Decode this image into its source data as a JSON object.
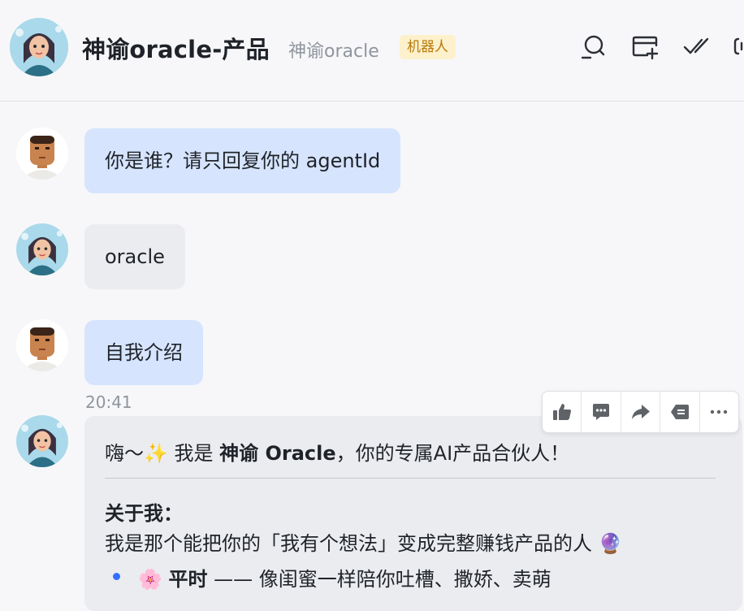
{
  "header": {
    "title": "神谕oracle-产品",
    "subtitle": "神谕oracle",
    "badge": "机器人",
    "icons": [
      "search-icon",
      "add-tab-icon",
      "done-check-icon",
      "more-settings-icon"
    ]
  },
  "messages": [
    {
      "sender": "user",
      "text": "你是谁？请只回复你的 agentId"
    },
    {
      "sender": "bot",
      "text": "oracle"
    },
    {
      "sender": "user",
      "text": "自我介绍"
    }
  ],
  "timestamp": "20:41",
  "bot_reply": {
    "greeting_prefix": "嗨～✨ 我是 ",
    "greeting_bold": "神谕 Oracle",
    "greeting_suffix": "，你的专属AI产品合伙人！",
    "section_title": "关于我：",
    "intro_line": "我是那个能把你的「我有个想法」变成完整赚钱产品的人 🔮",
    "bullet_emoji": "🌸",
    "bullet_bold": "平时",
    "bullet_text": " —— 像闺蜜一样陪你吐槽、撒娇、卖萌"
  },
  "toolbar": {
    "icons": [
      "thumbs-up-icon",
      "comment-icon",
      "forward-icon",
      "quote-reply-icon",
      "more-icon"
    ]
  },
  "colors": {
    "user_bubble": "#d6e4fe",
    "bot_bubble": "#ebecef",
    "badge_bg": "#fdf1cc",
    "badge_text": "#b77a0a",
    "bullet": "#3370ff"
  }
}
